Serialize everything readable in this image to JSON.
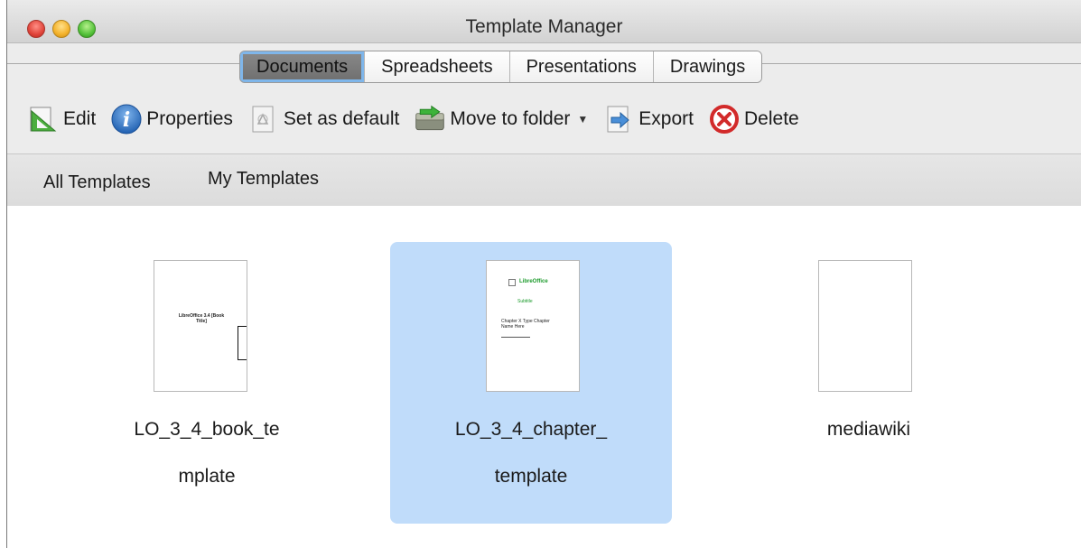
{
  "window": {
    "title": "Template Manager"
  },
  "tabs": [
    {
      "label": "Documents",
      "active": true
    },
    {
      "label": "Spreadsheets",
      "active": false
    },
    {
      "label": "Presentations",
      "active": false
    },
    {
      "label": "Drawings",
      "active": false
    }
  ],
  "toolbar": {
    "edit": "Edit",
    "properties": "Properties",
    "set_default": "Set as default",
    "move_to_folder": "Move to folder",
    "export": "Export",
    "delete": "Delete"
  },
  "filters": {
    "all": "All Templates",
    "mine": "My Templates"
  },
  "templates": [
    {
      "label_line1": "LO_3_4_book_te",
      "label_line2": "mplate",
      "selected": false,
      "thumb_text": "LibreOffice 3.4 [Book Title]"
    },
    {
      "label_line1": "LO_3_4_chapter_",
      "label_line2": "template",
      "selected": true,
      "thumb_brand": "LibreOffice",
      "thumb_heading": "Subtitle",
      "thumb_text": "Chapter X Type Chapter Name Here"
    },
    {
      "label_line1": "mediawiki",
      "label_line2": "",
      "selected": false
    }
  ],
  "colors": {
    "selection": "#c0dcfa",
    "active_tab_ring": "#7fb6ea"
  }
}
